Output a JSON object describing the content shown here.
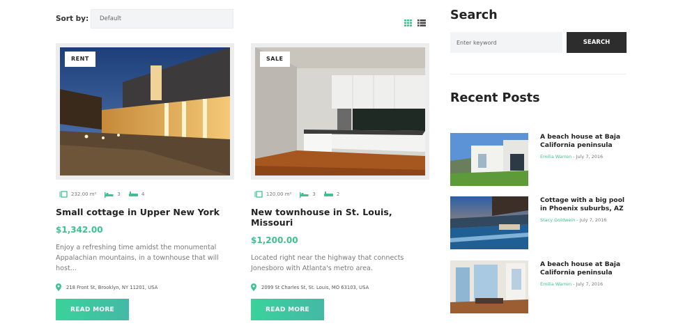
{
  "sort": {
    "label": "Sort by:",
    "value": "Default"
  },
  "listings": [
    {
      "badge": "RENT",
      "area": "232.00 m²",
      "beds": "3",
      "baths": "4",
      "title": "Small cottage in Upper New York",
      "price": "$1,342.00",
      "description": "Enjoy a refreshing time amidst the monumental Appalachian mountains, in a townhouse that will host...",
      "address": "218 Front St, Brooklyn, NY 11201, USA",
      "button": "READ MORE"
    },
    {
      "badge": "SALE",
      "area": "120.00 m²",
      "beds": "3",
      "baths": "2",
      "title": "New townhouse in St. Louis, Missouri",
      "price": "$1,200.00",
      "description": "Located right near the highway that connects Jonesboro with Atlanta's metro area.",
      "address": "2099 St Charles St, St. Louis, MO 63103, USA",
      "button": "READ MORE"
    }
  ],
  "sidebar": {
    "search": {
      "heading": "Search",
      "placeholder": "Enter keyword",
      "button": "SEARCH"
    },
    "recent": {
      "heading": "Recent Posts",
      "posts": [
        {
          "title": "A beach house at Baja California peninsula",
          "author": "Emilia Warren",
          "date": "July 7, 2016"
        },
        {
          "title": "Cottage with a big pool in Phoenix suburbs, AZ",
          "author": "Stacy Goldwein",
          "date": "July 7, 2016"
        },
        {
          "title": "A beach house at Baja California peninsula",
          "author": "Emilia Warren",
          "date": "July 7, 2016"
        }
      ]
    }
  },
  "colors": {
    "accent": "#3dc18f",
    "dark": "#2d2d2d"
  },
  "icons": [
    "grid-view-icon",
    "list-view-icon",
    "area-icon",
    "bed-icon",
    "bath-icon",
    "location-pin-icon"
  ]
}
